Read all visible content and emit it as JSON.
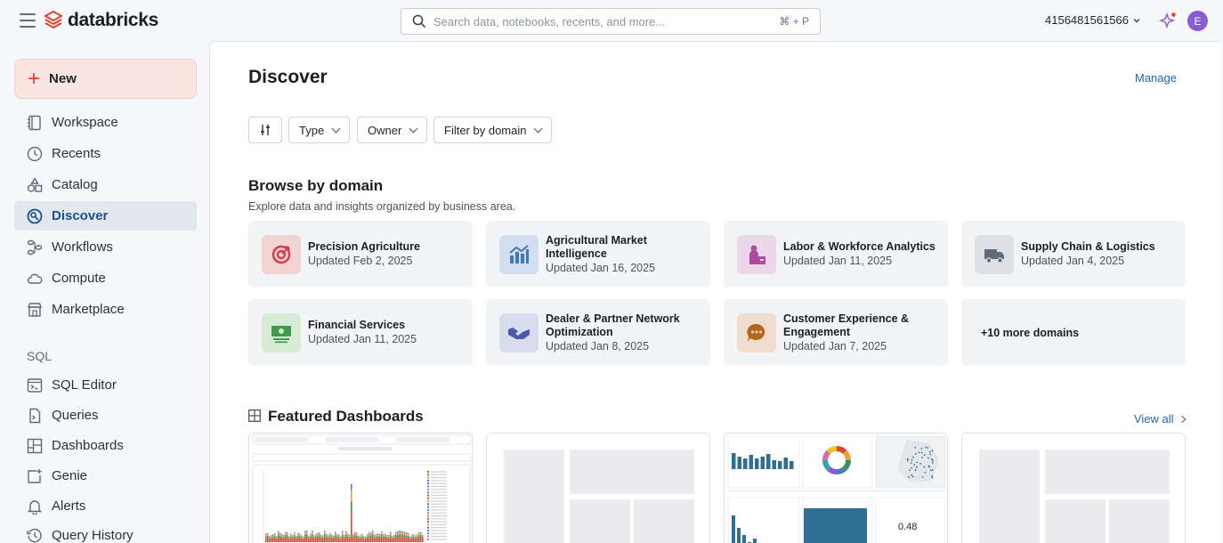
{
  "header": {
    "logo_text": "databricks",
    "search_placeholder": "Search data, notebooks, recents, and more...",
    "search_shortcut": "⌘ + P",
    "account": "4156481561566",
    "avatar_letter": "E"
  },
  "sidebar": {
    "new_label": "New",
    "items": [
      {
        "label": "Workspace",
        "icon": "workspace-icon"
      },
      {
        "label": "Recents",
        "icon": "clock-icon"
      },
      {
        "label": "Catalog",
        "icon": "catalog-icon"
      },
      {
        "label": "Discover",
        "icon": "discover-icon",
        "active": true
      },
      {
        "label": "Workflows",
        "icon": "workflows-icon"
      },
      {
        "label": "Compute",
        "icon": "cloud-icon"
      },
      {
        "label": "Marketplace",
        "icon": "store-icon"
      }
    ],
    "sql_label": "SQL",
    "sql_items": [
      {
        "label": "SQL Editor",
        "icon": "sql-editor-icon"
      },
      {
        "label": "Queries",
        "icon": "queries-icon"
      },
      {
        "label": "Dashboards",
        "icon": "dashboards-icon"
      },
      {
        "label": "Genie",
        "icon": "genie-icon"
      },
      {
        "label": "Alerts",
        "icon": "bell-icon"
      },
      {
        "label": "Query History",
        "icon": "history-icon"
      }
    ]
  },
  "main": {
    "title": "Discover",
    "manage_label": "Manage",
    "filters": {
      "type": "Type",
      "owner": "Owner",
      "domain": "Filter by domain"
    },
    "browse_title": "Browse by domain",
    "browse_subtitle": "Explore data and insights organized by business area.",
    "domains": [
      {
        "name": "Precision Agriculture",
        "updated": "Updated Feb 2, 2025",
        "color": "#f2d3d3",
        "icon": "target-icon"
      },
      {
        "name": "Agricultural Market Intelligence",
        "updated": "Updated Jan 16, 2025",
        "color": "#d3dff0",
        "icon": "market-chart-icon"
      },
      {
        "name": "Labor & Workforce Analytics",
        "updated": "Updated Jan 11, 2025",
        "color": "#ecd6ea",
        "icon": "workforce-icon"
      },
      {
        "name": "Supply Chain & Logistics",
        "updated": "Updated Jan 4, 2025",
        "color": "#dde0e4",
        "icon": "truck-icon"
      },
      {
        "name": "Financial Services",
        "updated": "Updated Jan 11, 2025",
        "color": "#d8ebd6",
        "icon": "money-icon"
      },
      {
        "name": "Dealer & Partner Network Optimization",
        "updated": "Updated Jan 8, 2025",
        "color": "#d8dcef",
        "icon": "handshake-icon"
      },
      {
        "name": "Customer Experience & Engagement",
        "updated": "Updated Jan 7, 2025",
        "color": "#efddd0",
        "icon": "chat-icon"
      }
    ],
    "more_domains": "+10 more domains",
    "featured_title": "Featured Dashboards",
    "view_all": "View all",
    "dashboard_metric": "0.48"
  }
}
